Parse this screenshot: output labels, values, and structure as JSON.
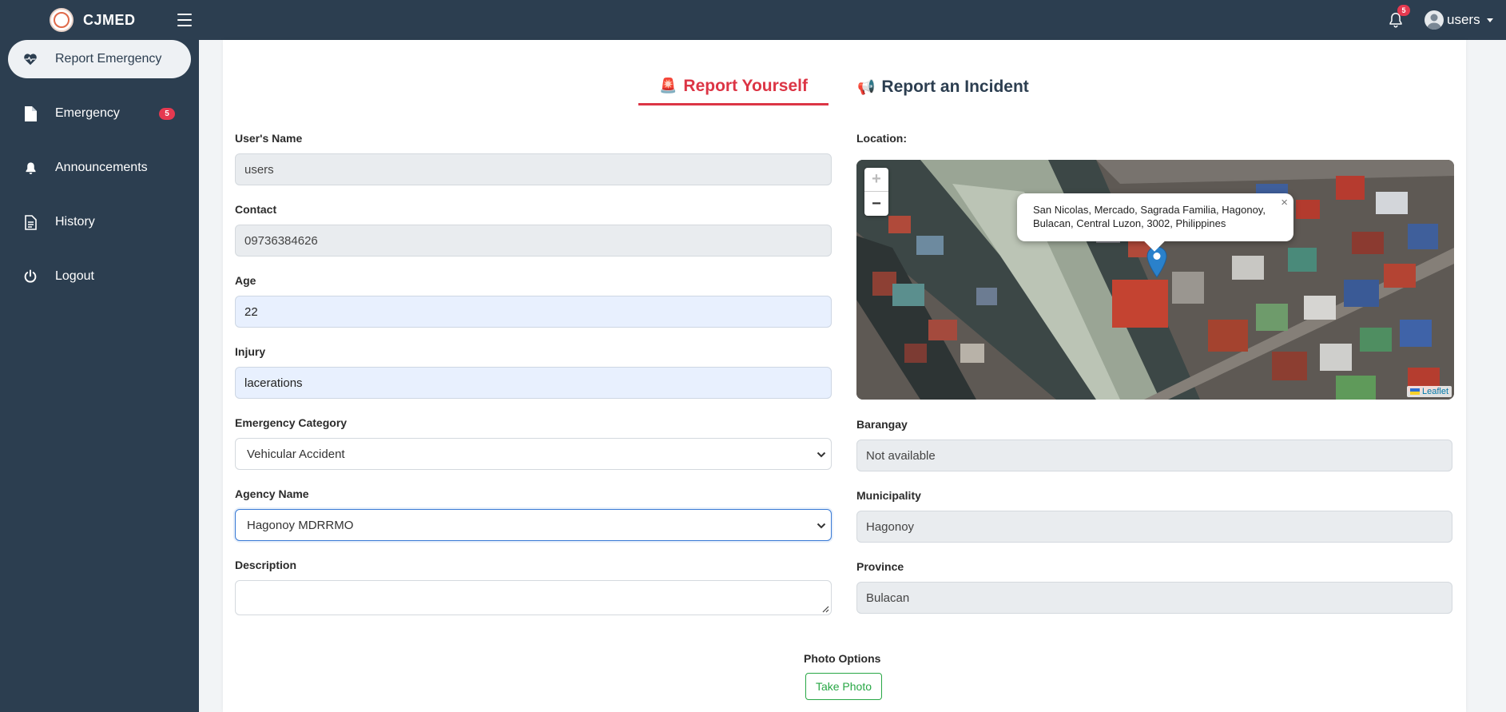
{
  "app": {
    "brand": "CJMED"
  },
  "header": {
    "notification_count": "5",
    "user_label": "users"
  },
  "sidebar": {
    "items": [
      {
        "label": "Report Emergency",
        "icon": "heartbeat-icon"
      },
      {
        "label": "Emergency",
        "icon": "file-icon",
        "badge": "5"
      },
      {
        "label": "Announcements",
        "icon": "bell-icon"
      },
      {
        "label": "History",
        "icon": "document-icon"
      },
      {
        "label": "Logout",
        "icon": "power-icon"
      }
    ]
  },
  "tabs": {
    "self": "Report Yourself",
    "incident": "Report an Incident"
  },
  "form": {
    "users_name": {
      "label": "User's Name",
      "value": "users"
    },
    "contact": {
      "label": "Contact",
      "value": "09736384626"
    },
    "age": {
      "label": "Age",
      "value": "22"
    },
    "injury": {
      "label": "Injury",
      "value": "lacerations"
    },
    "category": {
      "label": "Emergency Category",
      "value": "Vehicular Accident"
    },
    "agency": {
      "label": "Agency Name",
      "value": "Hagonoy MDRRMO"
    },
    "description": {
      "label": "Description",
      "value": ""
    }
  },
  "location": {
    "label": "Location:",
    "popup_text": "San Nicolas, Mercado, Sagrada Familia, Hagonoy, Bulacan, Central Luzon, 3002, Philippines",
    "zoom_in": "+",
    "zoom_out": "−",
    "close": "×",
    "attribution": "Leaflet",
    "barangay": {
      "label": "Barangay",
      "value": "Not available"
    },
    "municipality": {
      "label": "Municipality",
      "value": "Hagonoy"
    },
    "province": {
      "label": "Province",
      "value": "Bulacan"
    }
  },
  "photo": {
    "label": "Photo Options",
    "button": "Take Photo"
  },
  "colors": {
    "sidebar_bg": "#2c3e50",
    "accent_red": "#dc3545",
    "badge_red": "#e53950",
    "success_green": "#28a745"
  }
}
